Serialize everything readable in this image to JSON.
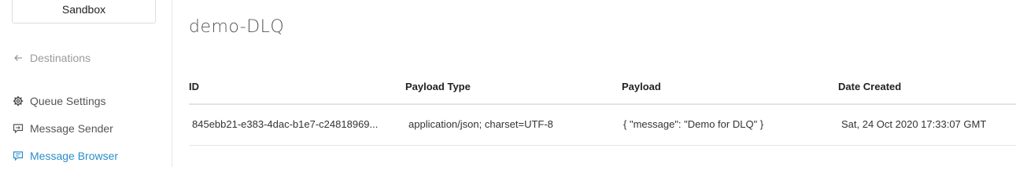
{
  "sidebar": {
    "environment": "Sandbox",
    "back_link": "Destinations",
    "items": [
      {
        "label": "Queue Settings",
        "icon": "gear-icon"
      },
      {
        "label": "Message Sender",
        "icon": "message-send-icon"
      },
      {
        "label": "Message Browser",
        "icon": "message-browse-icon",
        "active": true
      }
    ]
  },
  "main": {
    "title": "demo-DLQ",
    "table": {
      "columns": [
        "ID",
        "Payload Type",
        "Payload",
        "Date Created"
      ],
      "rows": [
        {
          "id": "845ebb21-e383-4dac-b1e7-c24818969...",
          "payload_type": "application/json; charset=UTF-8",
          "payload": "{ \"message\": \"Demo for DLQ\" }",
          "date_created": "Sat, 24 Oct 2020 17:33:07 GMT"
        }
      ]
    }
  },
  "colors": {
    "accent": "#2a8ec9",
    "muted": "#9a9a9a",
    "text": "#333333"
  }
}
